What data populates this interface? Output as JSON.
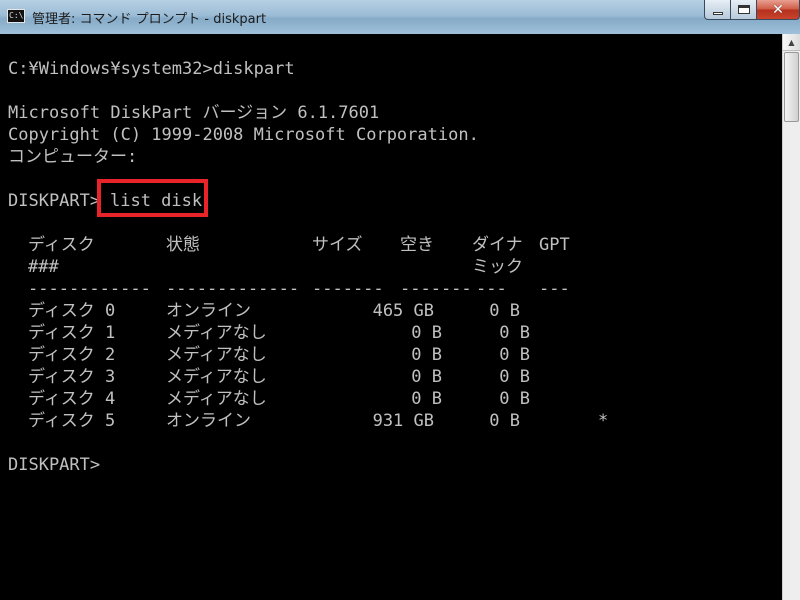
{
  "window": {
    "title": "管理者: コマンド プロンプト - diskpart",
    "icon_text": "C:\\"
  },
  "console": {
    "prompt_line": "C:¥Windows¥system32>diskpart",
    "version_line": "Microsoft DiskPart バージョン 6.1.7601",
    "copyright_line": "Copyright (C) 1999-2008 Microsoft Corporation.",
    "computer_line": "コンピューター:",
    "diskpart_prompt": "DISKPART>",
    "command": "list disk",
    "final_prompt": "DISKPART>"
  },
  "table": {
    "headers": {
      "disk": "ディスク",
      "disk_sub": "###",
      "status": "状態",
      "size": "サイズ",
      "free": "空き",
      "dynamic": "ダイナ",
      "dynamic_sub": "ミック",
      "gpt": "GPT"
    },
    "separators": {
      "disk": "------------",
      "status": "-------------",
      "size": "-------",
      "free": "-------",
      "dynamic": "---",
      "gpt": "---"
    },
    "rows": [
      {
        "disk": "ディスク 0",
        "status": "オンライン",
        "size": "465 GB",
        "free": "0 B",
        "gpt": ""
      },
      {
        "disk": "ディスク 1",
        "status": "メディアなし",
        "size": "0 B",
        "free": "0 B",
        "gpt": ""
      },
      {
        "disk": "ディスク 2",
        "status": "メディアなし",
        "size": "0 B",
        "free": "0 B",
        "gpt": ""
      },
      {
        "disk": "ディスク 3",
        "status": "メディアなし",
        "size": "0 B",
        "free": "0 B",
        "gpt": ""
      },
      {
        "disk": "ディスク 4",
        "status": "メディアなし",
        "size": "0 B",
        "free": "0 B",
        "gpt": ""
      },
      {
        "disk": "ディスク 5",
        "status": "オンライン",
        "size": "931 GB",
        "free": "0 B",
        "gpt": "*"
      }
    ]
  },
  "colors": {
    "console_bg": "#000000",
    "console_text": "#c0c0c0",
    "highlight": "#e8232a"
  }
}
